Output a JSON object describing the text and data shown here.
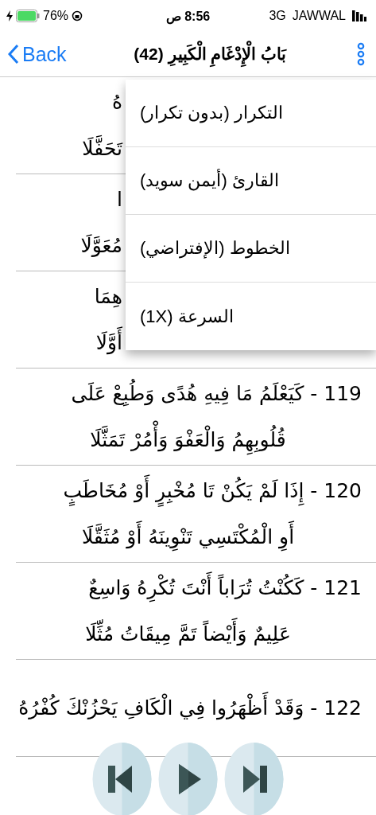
{
  "status_bar": {
    "battery": "76%",
    "time": "8:56 ص",
    "network": "3G",
    "carrier": "JAWWAL"
  },
  "nav": {
    "back": "Back",
    "title": "بَابُ الْإِدْغَامِ الْكَبِيرِ (42)"
  },
  "verses": [
    {
      "kind": "covered",
      "lines": [
        "هُ",
        "تَحَفَّلَا"
      ]
    },
    {
      "kind": "covered",
      "lines": [
        "ا",
        "مُعَوَّلَا"
      ]
    },
    {
      "kind": "covered",
      "lines": [
        "هِمَا",
        "أَوَّلَا"
      ]
    },
    {
      "kind": "full",
      "lines": [
        "119 - كَيَعْلَمُ مَا فِيهِ هُدًى وَطُبِعْ عَلَى",
        "قُلُوبِهِمُ وَالْعَفْوَ وَأْمُرْ تَمَثَّلَا"
      ]
    },
    {
      "kind": "full",
      "lines": [
        "120 - إِذَا لَمْ يَكُنْ تَا مُخْبِرٍ أَوْ مُخَاطَبٍ",
        "أَوِ الْمُكْتَسِي تَنْوِينَهُ أَوْ مُثَقَّلَا"
      ]
    },
    {
      "kind": "full",
      "lines": [
        "121 - كَكُنْتُ تُرَاباً أَنْتَ تُكْرِهُ وَاسِعٌ",
        "عَلِيمٌ وَأَيْضاً تَمَّ مِيقَاتُ مُثِّلَا"
      ]
    },
    {
      "kind": "full",
      "lines": [
        "122 - وَقَدْ أَظْهَرُوا فِي الْكَافِ يَحْزُنْكَ كُفْرُهُ"
      ]
    }
  ],
  "menu": [
    {
      "label": "التكرار (بدون تكرار)"
    },
    {
      "label": "القارئ (أيمن سويد)"
    },
    {
      "label": "الخطوط (الإفتراضي)"
    },
    {
      "label": "السرعة (1X)"
    }
  ],
  "player": [
    {
      "kind": "previous"
    },
    {
      "kind": "play"
    },
    {
      "kind": "next"
    }
  ]
}
